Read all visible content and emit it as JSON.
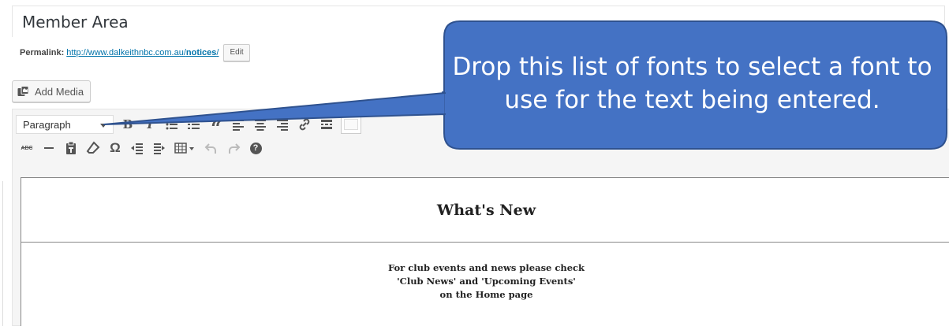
{
  "post": {
    "title": "Member Area"
  },
  "permalink": {
    "label": "Permalink:",
    "url_base": "http://www.dalkeithnbc.com.au/",
    "url_slug": "notices",
    "url_tail": "/",
    "edit_label": "Edit"
  },
  "media": {
    "add_media_label": "Add Media",
    "icon": "add-media-icon"
  },
  "toolbar": {
    "format_select_value": "Paragraph",
    "row1_icons": [
      "bold-icon",
      "italic-icon",
      "bulleted-list-icon",
      "numbered-list-icon",
      "blockquote-icon",
      "align-left-icon",
      "align-center-icon",
      "align-right-icon",
      "link-icon",
      "read-more-icon",
      "toolbar-toggle-icon"
    ],
    "row2_icons": [
      "strikethrough-icon",
      "horizontal-line-icon",
      "paste-as-text-icon",
      "clear-formatting-icon",
      "special-character-icon",
      "decrease-indent-icon",
      "increase-indent-icon",
      "table-icon",
      "undo-icon",
      "redo-icon",
      "help-icon"
    ],
    "bold_glyph": "B",
    "italic_glyph": "I",
    "quote_glyph": "“",
    "strike_glyph": "ABC",
    "omega_glyph": "Ω",
    "help_glyph": "?"
  },
  "content": {
    "heading": "What's New",
    "body_lines": [
      "For club events and news please check",
      "'Club News' and 'Upcoming Events'",
      "on the Home page"
    ]
  },
  "callout": {
    "lines": [
      "Drop this list of fonts to select a font to",
      "use for the text being entered."
    ],
    "fill_color": "#4472c4",
    "border_color": "#2f528f"
  }
}
